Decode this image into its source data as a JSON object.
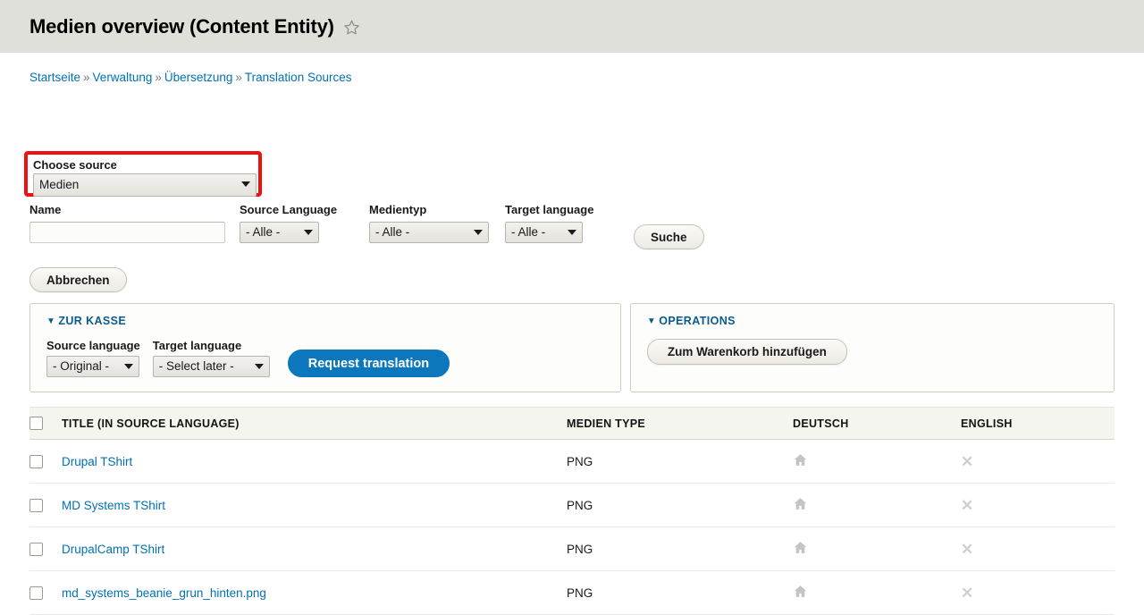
{
  "header": {
    "title": "Medien overview (Content Entity)",
    "favorite_icon": "star-outline-icon"
  },
  "breadcrumb": {
    "separator": "»",
    "items": [
      {
        "label": "Startseite"
      },
      {
        "label": "Verwaltung"
      },
      {
        "label": "Übersetzung"
      },
      {
        "label": "Translation Sources"
      }
    ]
  },
  "choose_source": {
    "label": "Choose source",
    "value": "Medien",
    "highlight_color": "#ee1111"
  },
  "filters": {
    "name": {
      "label": "Name",
      "value": "",
      "placeholder": ""
    },
    "source_language": {
      "label": "Source Language",
      "value": "- Alle -"
    },
    "media_type": {
      "label": "Medientyp",
      "value": "- Alle -"
    },
    "target_language": {
      "label": "Target language",
      "value": "- Alle -"
    },
    "search_button": "Suche",
    "cancel_button": "Abbrechen"
  },
  "checkout_panel": {
    "title": "Zur Kasse",
    "toggle_icon": "▼",
    "source_language": {
      "label": "Source language",
      "value": "- Original -"
    },
    "target_language": {
      "label": "Target language",
      "value": "- Select later -"
    },
    "request_button": "Request translation",
    "button_color": "#0d77bd"
  },
  "operations_panel": {
    "title": "Operations",
    "toggle_icon": "▼",
    "add_to_cart_button": "Zum Warenkorb hinzufügen"
  },
  "table": {
    "columns": {
      "select_all": "",
      "title": "Title (in source language)",
      "media_type": "Medien type",
      "deutsch": "Deutsch",
      "english": "English"
    },
    "rows": [
      {
        "title": "Drupal TShirt",
        "media_type": "PNG",
        "deutsch_icon": "home-icon",
        "english_icon": "x-icon",
        "english_label": "✕"
      },
      {
        "title": "MD Systems TShirt",
        "media_type": "PNG",
        "deutsch_icon": "home-icon",
        "english_icon": "x-icon",
        "english_label": "✕"
      },
      {
        "title": "DrupalCamp TShirt",
        "media_type": "PNG",
        "deutsch_icon": "home-icon",
        "english_icon": "x-icon",
        "english_label": "✕"
      },
      {
        "title": "md_systems_beanie_grun_hinten.png",
        "media_type": "PNG",
        "deutsch_icon": "home-icon",
        "english_icon": "x-icon",
        "english_label": "✕"
      }
    ]
  }
}
